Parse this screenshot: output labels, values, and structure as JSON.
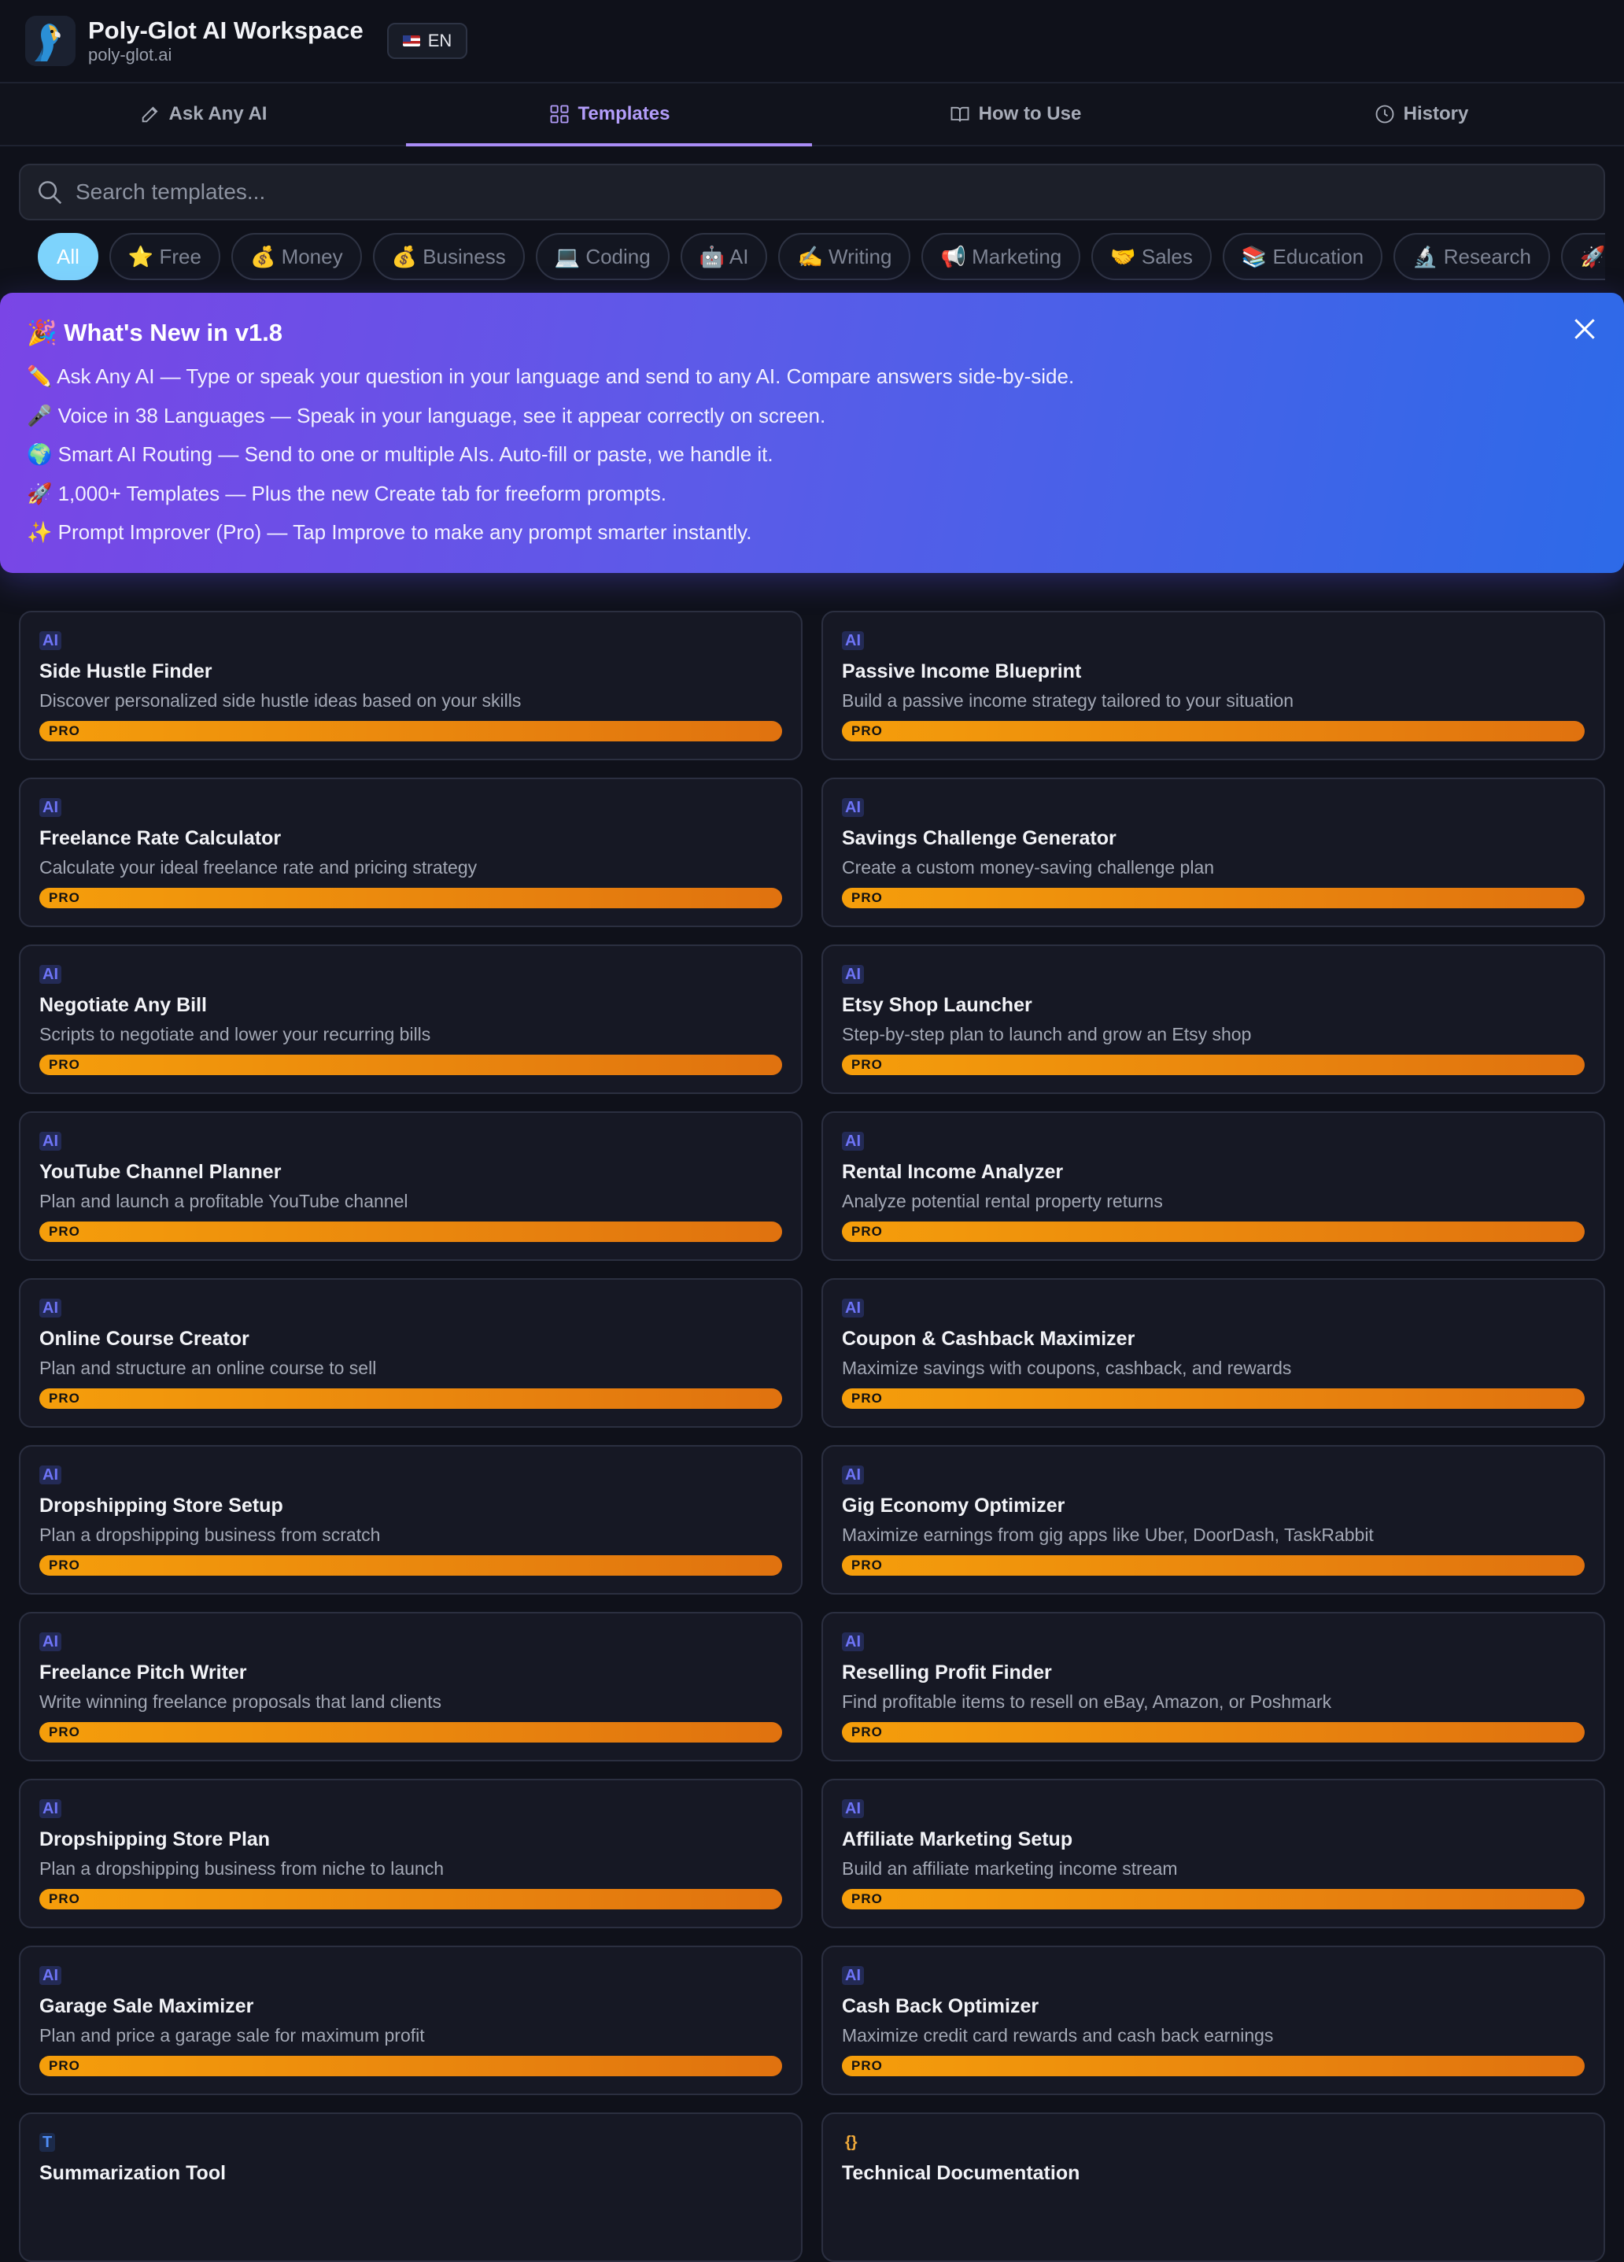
{
  "header": {
    "title": "Poly-Glot AI Workspace",
    "subtitle": "poly-glot.ai",
    "lang_label": "EN",
    "logo_icon": "parrot-logo"
  },
  "tabs": [
    {
      "label": "Ask Any AI",
      "icon": "pencil-icon"
    },
    {
      "label": "Templates",
      "icon": "grid-icon",
      "active": true
    },
    {
      "label": "How to Use",
      "icon": "book-icon"
    },
    {
      "label": "History",
      "icon": "clock-icon"
    }
  ],
  "search": {
    "placeholder": "Search templates..."
  },
  "categories": [
    "All",
    "⭐ Free",
    "💰 Money",
    "💰 Business",
    "💻 Coding",
    "🤖 AI",
    "✍️ Writing",
    "📢 Marketing",
    "🤝 Sales",
    "📚 Education",
    "🔬 Research",
    "🚀 C"
  ],
  "banner": {
    "title": "🎉 What's New in v1.8",
    "lines": [
      "✏️ Ask Any AI — Type or speak your question in your language and send to any AI. Compare answers side-by-side.",
      "🎤 Voice in 38 Languages — Speak in your language, see it appear correctly on screen.",
      "🌍 Smart AI Routing — Send to one or multiple AIs. Auto-fill or paste, we handle it.",
      "🚀 1,000+ Templates — Plus the new Create tab for freeform prompts.",
      "✨ Prompt Improver (Pro) — Tap Improve to make any prompt smarter instantly."
    ]
  },
  "cards": [
    {
      "badge": "AI",
      "title": "Side Hustle Finder",
      "desc": "Discover personalized side hustle ideas based on your skills",
      "pro": "PRO"
    },
    {
      "badge": "AI",
      "title": "Passive Income Blueprint",
      "desc": "Build a passive income strategy tailored to your situation",
      "pro": "PRO"
    },
    {
      "badge": "AI",
      "title": "Freelance Rate Calculator",
      "desc": "Calculate your ideal freelance rate and pricing strategy",
      "pro": "PRO"
    },
    {
      "badge": "AI",
      "title": "Savings Challenge Generator",
      "desc": "Create a custom money-saving challenge plan",
      "pro": "PRO"
    },
    {
      "badge": "AI",
      "title": "Negotiate Any Bill",
      "desc": "Scripts to negotiate and lower your recurring bills",
      "pro": "PRO"
    },
    {
      "badge": "AI",
      "title": "Etsy Shop Launcher",
      "desc": "Step-by-step plan to launch and grow an Etsy shop",
      "pro": "PRO"
    },
    {
      "badge": "AI",
      "title": "YouTube Channel Planner",
      "desc": "Plan and launch a profitable YouTube channel",
      "pro": "PRO"
    },
    {
      "badge": "AI",
      "title": "Rental Income Analyzer",
      "desc": "Analyze potential rental property returns",
      "pro": "PRO"
    },
    {
      "badge": "AI",
      "title": "Online Course Creator",
      "desc": "Plan and structure an online course to sell",
      "pro": "PRO"
    },
    {
      "badge": "AI",
      "title": "Coupon & Cashback Maximizer",
      "desc": "Maximize savings with coupons, cashback, and rewards",
      "pro": "PRO"
    },
    {
      "badge": "AI",
      "title": "Dropshipping Store Setup",
      "desc": "Plan a dropshipping business from scratch",
      "pro": "PRO"
    },
    {
      "badge": "AI",
      "title": "Gig Economy Optimizer",
      "desc": "Maximize earnings from gig apps like Uber, DoorDash, TaskRabbit",
      "pro": "PRO"
    },
    {
      "badge": "AI",
      "title": "Freelance Pitch Writer",
      "desc": "Write winning freelance proposals that land clients",
      "pro": "PRO"
    },
    {
      "badge": "AI",
      "title": "Reselling Profit Finder",
      "desc": "Find profitable items to resell on eBay, Amazon, or Poshmark",
      "pro": "PRO"
    },
    {
      "badge": "AI",
      "title": "Dropshipping Store Plan",
      "desc": "Plan a dropshipping business from niche to launch",
      "pro": "PRO"
    },
    {
      "badge": "AI",
      "title": "Affiliate Marketing Setup",
      "desc": "Build an affiliate marketing income stream",
      "pro": "PRO"
    },
    {
      "badge": "AI",
      "title": "Garage Sale Maximizer",
      "desc": "Plan and price a garage sale for maximum profit",
      "pro": "PRO"
    },
    {
      "badge": "AI",
      "title": "Cash Back Optimizer",
      "desc": "Maximize credit card rewards and cash back earnings",
      "pro": "PRO"
    },
    {
      "badge": "T",
      "title": "Summarization Tool",
      "desc": "",
      "pro": ""
    },
    {
      "badge": "{}",
      "title": "Technical Documentation",
      "desc": "",
      "pro": ""
    }
  ]
}
